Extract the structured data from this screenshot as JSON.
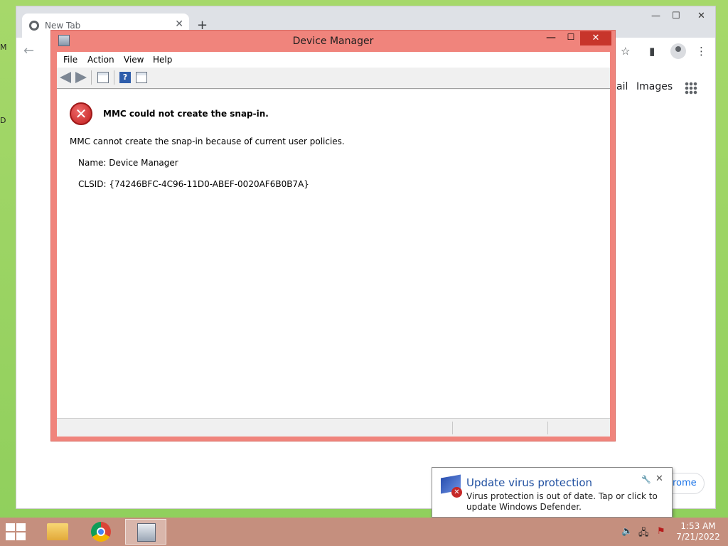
{
  "desktop": {
    "edge_letters": [
      "M",
      "D"
    ]
  },
  "chrome": {
    "tab_title": "New Tab",
    "tab_close": "✕",
    "new_tab": "+",
    "window_buttons": {
      "minimize": "—",
      "maximize": "☐",
      "close": "✕"
    },
    "back": "←",
    "bookmark_icon": "☆",
    "sidebar_icon": "▮",
    "menu_icon": "⋮",
    "links": {
      "gmail": "ail",
      "images": "Images"
    },
    "customize_label": "rome"
  },
  "device_manager": {
    "title": "Device Manager",
    "window_buttons": {
      "minimize": "—",
      "maximize": "☐",
      "close": "✕"
    },
    "menu": [
      "File",
      "Action",
      "View",
      "Help"
    ],
    "toolbar": {
      "help_glyph": "?"
    },
    "error_glyph": "✕",
    "error_title": "MMC could not create the snap-in.",
    "error_message": "MMC cannot create the snap-in because of current user policies.",
    "name_line": "Name: Device Manager",
    "clsid_line": "CLSID: {74246BFC-4C96-11D0-ABEF-0020AF6B0B7A}"
  },
  "notification": {
    "title": "Update virus protection",
    "body": "Virus protection is out of date. Tap or click to update Windows Defender.",
    "settings_glyph": "🔧",
    "close_glyph": "✕",
    "badge_glyph": "✕"
  },
  "taskbar": {
    "tray": {
      "volume": "🔈",
      "network": "🖧",
      "flag": "⚑"
    },
    "time": "1:53 AM",
    "date": "7/21/2022"
  },
  "colors": {
    "window_frame": "#f0847c",
    "close_button": "#c7352b",
    "taskbar": "#c58f7e",
    "desktop": "#a6d86a",
    "link_blue": "#1a73e8"
  }
}
